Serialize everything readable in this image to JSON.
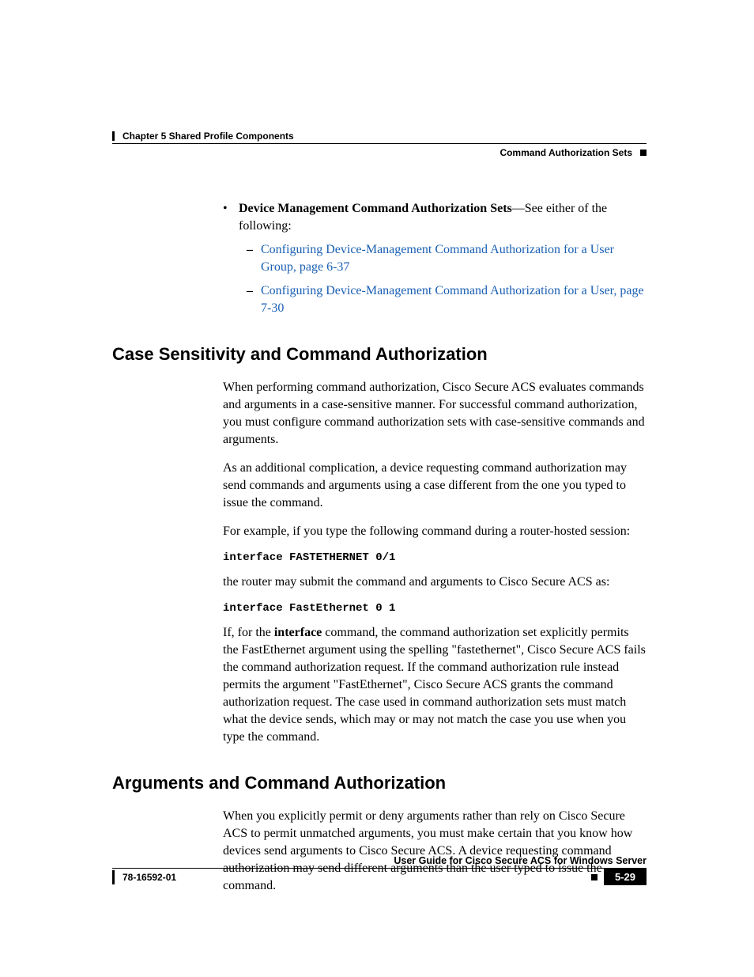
{
  "header": {
    "chapter": "Chapter 5      Shared Profile Components",
    "section": "Command Authorization Sets"
  },
  "top_bullet": {
    "lead_bold": "Device Management Command Authorization Sets",
    "lead_rest": "—See either of the following:",
    "sub1": "Configuring Device-Management Command Authorization for a User Group, page 6-37",
    "sub2": "Configuring Device-Management Command Authorization for a User, page 7-30"
  },
  "section1": {
    "title": "Case Sensitivity and Command Authorization",
    "p1": "When performing command authorization, Cisco Secure ACS evaluates commands and arguments in a case-sensitive manner. For successful command authorization, you must configure command authorization sets with case-sensitive commands and arguments.",
    "p2": "As an additional complication, a device requesting command authorization may send commands and arguments using a case different from the one you typed to issue the command.",
    "p3": "For example, if you type the following command during a router-hosted session:",
    "code1": "interface FASTETHERNET 0/1",
    "p4": "the router may submit the command and arguments to Cisco Secure ACS as:",
    "code2": "interface FastEthernet 0 1",
    "p5a": "If, for the ",
    "p5b": "interface",
    "p5c": " command, the command authorization set explicitly permits the FastEthernet argument using the spelling \"fastethernet\", Cisco Secure ACS fails the command authorization request. If the command authorization rule instead permits the argument \"FastEthernet\", Cisco Secure ACS grants the command authorization request. The case used in command authorization sets must match what the device sends, which may or may not match the case you use when you type the command."
  },
  "section2": {
    "title": "Arguments and Command Authorization",
    "p1": "When you explicitly permit or deny arguments rather than rely on Cisco Secure ACS to permit unmatched arguments, you must make certain that you know how devices send arguments to Cisco Secure ACS. A device requesting command authorization may send different arguments than the user typed to issue the command."
  },
  "footer": {
    "guide": "User Guide for Cisco Secure ACS for Windows Server",
    "doc_id": "78-16592-01",
    "page": "5-29"
  }
}
